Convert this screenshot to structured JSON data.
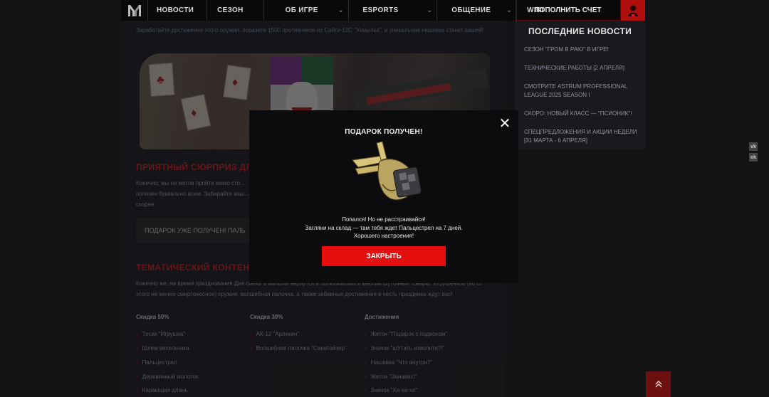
{
  "nav": {
    "items": [
      {
        "label": "НОВОСТИ"
      },
      {
        "label": "СЕЗОН"
      },
      {
        "label": "ОБ ИГРЕ"
      },
      {
        "label": "ESPORTS"
      },
      {
        "label": "ОБЩЕНИЕ"
      },
      {
        "label": "WIKI"
      }
    ],
    "topup_label": "ПОПОЛНИТЬ СЧЕТ"
  },
  "article": {
    "intro": "Заработайте достижение этого оружия: поразите 1500 противников из Сайги-12С \"Ухмылка\", и уникальная нашивка станет вашей!",
    "section1_title": "ПРИЯТНЫЙ СЮРПРИЗ ДЛЯ",
    "section1_text": "Конечно, мы не могли пройти мимо сто... полезен буквально всем. Забирайте ваш... скорее.",
    "gift_box": "ПОДАРОК УЖЕ ПОЛУЧЕН! ПАЛЬ",
    "section2_title": "ТЕМАТИЧЕСКИЙ КОНТЕНТ Е",
    "section2_text": "Конечно же, на время празднования Дня смеха в магазин вернутся и полюбившиеся многим шуточные товары. Игрушечное (но от этого не менее смертоносное) оружие, волшебная палочка, а также забавные достижения в честь праздника ждут вас!",
    "columns": [
      {
        "title": "Скидка 50%",
        "items": [
          "Тесак \"Игрушка\"",
          "Шлем весельчака",
          "Пальцестрел",
          "Деревянный молоток",
          "Карающая длань"
        ]
      },
      {
        "title": "Скидка 30%",
        "items": [
          "АК-12 \"Арлекин\"",
          "Волшебная палочка \"Санитайзер\""
        ]
      },
      {
        "title": "Достижения",
        "items": [
          "Жетон \"Подарок с подвохом\"",
          "Значок \"шУтить изволите?!\"",
          "Нашивка \"Что внутри?\"",
          "Жетон \"Занавес!\"",
          "Значок \"Ха-ха-ха\""
        ]
      }
    ]
  },
  "news": {
    "title": "ПОСЛЕДНИЕ НОВОСТИ",
    "items": [
      "СЕЗОН \"ГРОМ В РАЮ\" В ИГРЕ!",
      "ТЕХНИЧЕСКИЕ РАБОТЫ [2 АПРЕЛЯ]",
      "СМОТРИТЕ ASTRUM PROFESSIONAL LEAGUE 2025 SEASON I",
      "СКОРО: НОВЫЙ КЛАСС — \"ПСИОНИК\"!",
      "СПЕЦПРЕДЛОЖЕНИЯ И АКЦИИ НЕДЕЛИ [31 МАРТА - 6 АПРЕЛЯ]"
    ]
  },
  "social": {
    "vk": "vk",
    "ok": "ok"
  },
  "modal": {
    "title": "ПОДАРОК ПОЛУЧЕН!",
    "line1": "Попался! Но не расстраивайся!",
    "line2": "Загляни на склад — там тебя ждет Пальцестрел на 7 дней.",
    "line3": "Хорошего настроения!",
    "button_label": "ЗАКРЫТЬ",
    "close_symbol": "✕"
  },
  "colors": {
    "accent": "#e60f0f",
    "brand_red": "#b00d0d"
  }
}
